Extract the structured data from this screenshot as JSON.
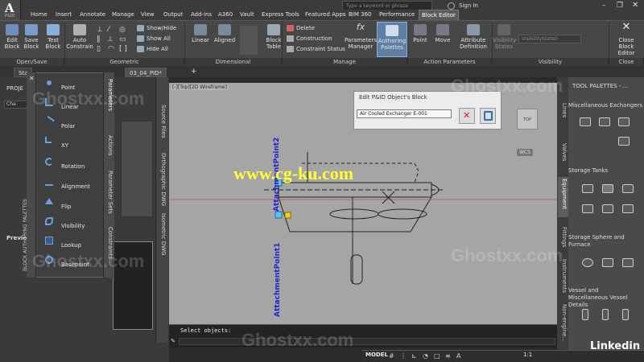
{
  "app": {
    "logo_letter": "A",
    "logo_sub": "P&ID"
  },
  "ribbon_tabs": [
    "Home",
    "Insert",
    "Annotate",
    "Manage",
    "View",
    "Output",
    "Add-ins",
    "A360",
    "Vault",
    "Express Tools",
    "Featured Apps",
    "BIM 360",
    "Performance",
    "Block Editor"
  ],
  "search": {
    "placeholder": "Type a keyword or phrase"
  },
  "signin": "Sign In",
  "ribbon": {
    "open_save": {
      "edit_block": "Edit Block",
      "save_block": "Save Block",
      "test_block": "Test Block",
      "label": "Open/Save"
    },
    "geometric": {
      "auto_constrain": "Auto Constrain",
      "show_hide": "Show/Hide",
      "show_all": "Show All",
      "hide_all": "Hide All",
      "label": "Geometric"
    },
    "dimensional": {
      "linear": "Linear",
      "aligned": "Aligned",
      "label": "Dimensional"
    },
    "manage": {
      "delete": "Delete",
      "construction": "Construction",
      "constraint_status": "Constraint Status",
      "block_table": "Block Table",
      "parameters_manager": "Parameters Manager",
      "authoring_palettes": "Authoring Palettes",
      "label": "Manage"
    },
    "action_params": {
      "point": "Point",
      "move": "Move",
      "attribute_definition": "Attribute Definition",
      "label": "Action Parameters"
    },
    "visibility": {
      "visibility_states": "Visibility States",
      "visibility_state_value": "VisibilityState0",
      "label": "Visibility"
    },
    "close": {
      "close_block_editor": "Close Block Editor",
      "label": "Close"
    }
  },
  "doc_tabs": [
    "Sta",
    "03_04_PID*"
  ],
  "palette": {
    "title": "BLOCK AUTHORING PALETTES",
    "items": [
      "Point",
      "Linear",
      "Polar",
      "XY",
      "Rotation",
      "Alignment",
      "Flip",
      "Visibility",
      "Lookup",
      "Basepoint"
    ],
    "side_tabs": [
      "Parameters",
      "Actions",
      "Parameter Sets",
      "Constraints"
    ]
  },
  "left_panel": {
    "project_label": "PROJE",
    "preview_label": "Previe",
    "chat_label": "Cha",
    "source_files": "Source Files",
    "ortho": "Orthographic DWG",
    "iso": "Isometric DWG"
  },
  "canvas": {
    "view_label": "[-][Top][2D Wireframe]",
    "attach1": "AttachmentPoint1",
    "attach2": "AttachmentPoint2"
  },
  "dialog": {
    "title": "Edit P&ID Object's Block",
    "field_value": "Air Cooled Exchanger E-001"
  },
  "viewcube": {
    "top": "TOP",
    "wcs": "WCS"
  },
  "command": {
    "text": "Select objects:"
  },
  "tool_palettes": {
    "title": "TOOL PALETTES - ...",
    "sections": [
      "Miscellaneous Exchangers",
      "Storage Tanks",
      "Storage Sphere and Furnace",
      "Vessel and Miscellaneous Vessel Details"
    ],
    "side_tabs": [
      "Lines",
      "Valves",
      "Equipment",
      "Fittings",
      "Instruments",
      "Non-engine..."
    ]
  },
  "status": {
    "model": "MODEL",
    "scale": "1:1",
    "brand": "Linkedin"
  },
  "watermarks": {
    "cg": "www.cg-ku.com",
    "ghost": "Ghostxx.com"
  }
}
